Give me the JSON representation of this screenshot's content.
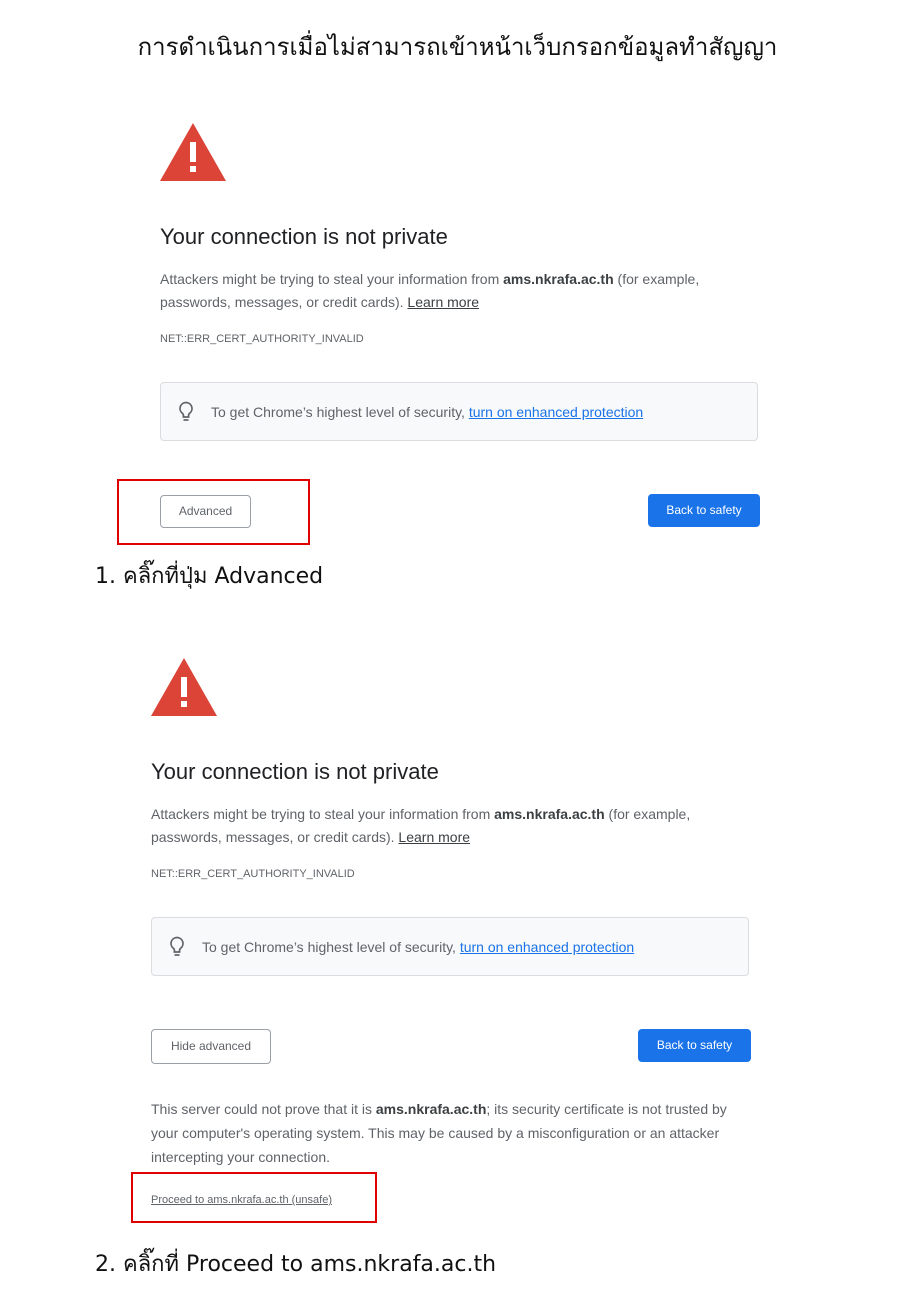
{
  "page_title": "การดำเนินการเมื่อไม่สามารถเข้าหน้าเว็บกรอกข้อมูลทำสัญญา",
  "colors": {
    "warning_red": "#db4437",
    "chrome_blue": "#1a73e8",
    "annotation_red": "#e00000"
  },
  "panel1": {
    "warning_icon": "warning-triangle-icon",
    "heading": "Your connection is not private",
    "desc_pre": "Attackers might be trying to steal your information from ",
    "domain": "ams.nkrafa.ac.th",
    "desc_post": " (for example, passwords, messages, or credit cards). ",
    "learn_more": "Learn more",
    "error_code": "NET::ERR_CERT_AUTHORITY_INVALID",
    "tip_icon": "lightbulb-icon",
    "tip_text": "To get Chrome’s highest level of security, ",
    "tip_link": "turn on enhanced protection",
    "advanced_button": "Advanced",
    "back_button": "Back to safety"
  },
  "step1_caption": "1. คลิ๊กที่ปุ่ม Advanced",
  "panel2": {
    "warning_icon": "warning-triangle-icon",
    "heading": "Your connection is not private",
    "desc_pre": "Attackers might be trying to steal your information from ",
    "domain": "ams.nkrafa.ac.th",
    "desc_post": " (for example, passwords, messages, or credit cards). ",
    "learn_more": "Learn more",
    "error_code": "NET::ERR_CERT_AUTHORITY_INVALID",
    "tip_icon": "lightbulb-icon",
    "tip_text": "To get Chrome’s highest level of security, ",
    "tip_link": "turn on enhanced protection",
    "hide_button": "Hide advanced",
    "back_button": "Back to safety",
    "details_pre": "This server could not prove that it is ",
    "details_domain": "ams.nkrafa.ac.th",
    "details_post": "; its security certificate is not trusted by your computer's operating system. This may be caused by a misconfiguration or an attacker intercepting your connection.",
    "proceed_link": "Proceed to ams.nkrafa.ac.th (unsafe)"
  },
  "step2_caption": "2. คลิ๊กที่ Proceed to ams.nkrafa.ac.th"
}
